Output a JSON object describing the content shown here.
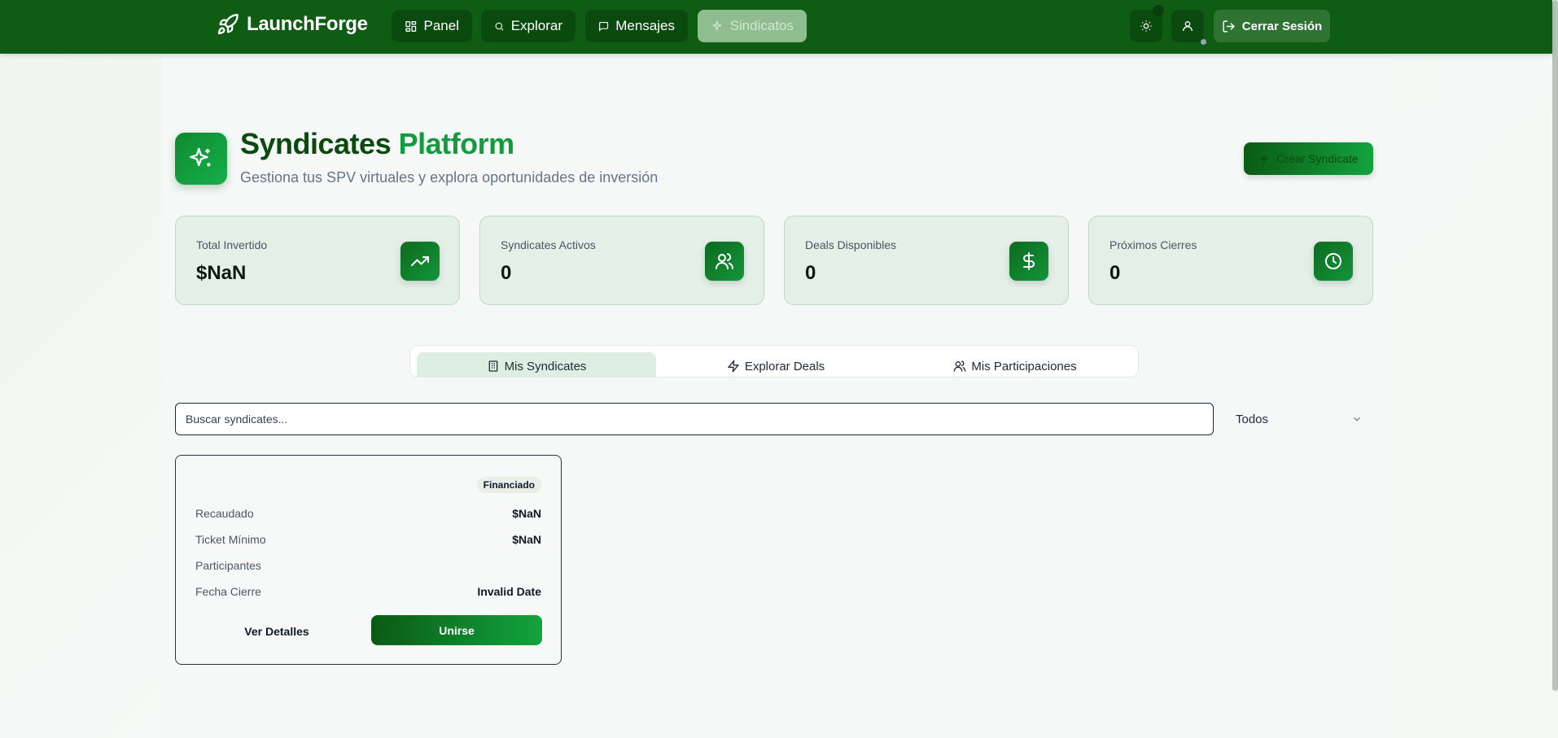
{
  "topbar": {
    "brand": "LaunchForge",
    "nav": [
      {
        "label": "Panel",
        "icon": "grid-icon"
      },
      {
        "label": "Explorar",
        "icon": "search-icon"
      },
      {
        "label": "Mensajes",
        "icon": "message-icon"
      },
      {
        "label": "Sindicatos",
        "icon": "sparkles-icon",
        "active": true
      }
    ],
    "logout_label": "Cerrar Sesión"
  },
  "header": {
    "title_main": "Syndicates",
    "title_accent": "Platform",
    "subtitle": "Gestiona tus SPV virtuales y explora oportunidades de inversión",
    "create_label": "Crear Syndicate"
  },
  "stats": [
    {
      "label": "Total Invertido",
      "value": "$NaN",
      "icon": "trending-up-icon"
    },
    {
      "label": "Syndicates Activos",
      "value": "0",
      "icon": "users-icon"
    },
    {
      "label": "Deals Disponibles",
      "value": "0",
      "icon": "dollar-icon"
    },
    {
      "label": "Próximos Cierres",
      "value": "0",
      "icon": "clock-icon"
    }
  ],
  "tabs": [
    {
      "label": "Mis Syndicates",
      "active": true
    },
    {
      "label": "Explorar Deals"
    },
    {
      "label": "Mis Participaciones"
    }
  ],
  "filters": {
    "search_placeholder": "Buscar syndicates...",
    "status_selected": "Todos"
  },
  "card": {
    "badge": "Financiado",
    "rows": [
      {
        "k": "Recaudado",
        "v": "$NaN"
      },
      {
        "k": "Ticket Mínimo",
        "v": "$NaN"
      },
      {
        "k": "Participantes",
        "v": ""
      },
      {
        "k": "Fecha Cierre",
        "v": "Invalid Date"
      }
    ],
    "details_label": "Ver Detalles",
    "join_label": "Unirse"
  },
  "colors": {
    "primary": "#0f5c14",
    "accent": "#119c3e",
    "card_bg": "#e3efe7"
  }
}
